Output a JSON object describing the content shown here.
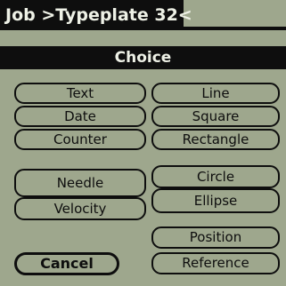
{
  "app": {
    "title": "Job >Typeplate 32<"
  },
  "dialog": {
    "title": "Choice"
  },
  "buttons": {
    "text": "Text",
    "date": "Date",
    "counter": "Counter",
    "needle": "Needle",
    "velocity": "Velocity",
    "line": "Line",
    "square": "Square",
    "rectangle": "Rectangle",
    "circle": "Circle",
    "ellipse": "Ellipse",
    "position": "Position",
    "reference": "Reference",
    "cancel": "Cancel"
  },
  "colors": {
    "background": "#9ea78d",
    "ink": "#0e0e0e",
    "inverse_text": "#eef1e6"
  }
}
